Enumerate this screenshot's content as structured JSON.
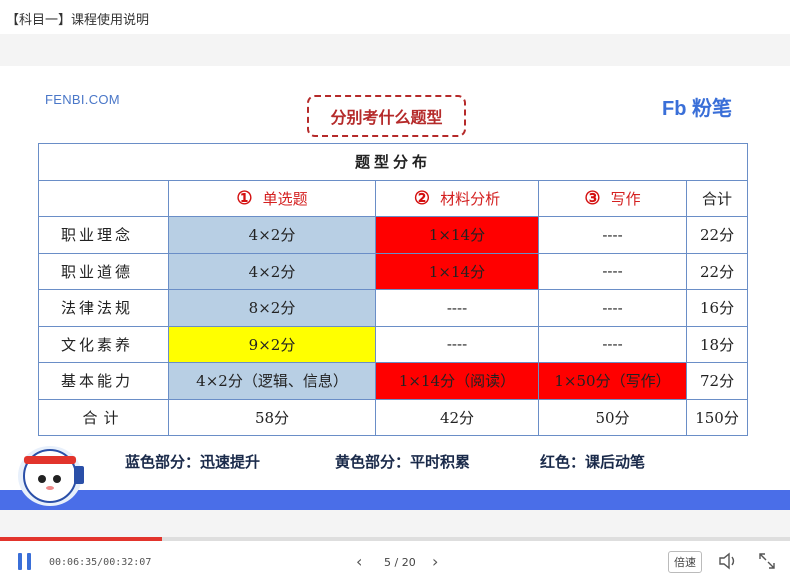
{
  "window": {
    "title": "【科目一】课程使用说明"
  },
  "slide": {
    "brand_left": "FENBI.COM",
    "brand_right": "Fb 粉笔",
    "heading": "分别考什么题型"
  },
  "table": {
    "title": "题型分布",
    "headers": [
      {
        "num": "①",
        "label": "单选题"
      },
      {
        "num": "②",
        "label": "材料分析"
      },
      {
        "num": "③",
        "label": "写作"
      },
      {
        "num": "",
        "label": "合计"
      }
    ],
    "rows": [
      {
        "label": "职业理念",
        "cells": [
          "4×2分",
          "1×14分",
          "----",
          "22分"
        ]
      },
      {
        "label": "职业道德",
        "cells": [
          "4×2分",
          "1×14分",
          "----",
          "22分"
        ]
      },
      {
        "label": "法律法规",
        "cells": [
          "8×2分",
          "----",
          "----",
          "16分"
        ]
      },
      {
        "label": "文化素养",
        "cells": [
          "9×2分",
          "----",
          "----",
          "18分"
        ]
      },
      {
        "label": "基本能力",
        "cells": [
          "4×2分（逻辑、信息）",
          "1×14分（阅读）",
          "1×50分（写作）",
          "72分"
        ]
      },
      {
        "label": "合计",
        "cells": [
          "58分",
          "42分",
          "50分",
          "150分"
        ]
      }
    ]
  },
  "legend": {
    "blue": "蓝色部分：迅速提升",
    "yellow": "黄色部分：平时积累",
    "red": "红色：课后动笔"
  },
  "player": {
    "time": "00:06:35/00:32:07",
    "progress": 0.205,
    "page": "5 / 20",
    "speed_label": "倍速"
  },
  "colors": {
    "blue_cell": "#b8cfe4",
    "red_cell": "#ff0000",
    "yellow_cell": "#ffff00",
    "accent": "#3a6fd8"
  }
}
